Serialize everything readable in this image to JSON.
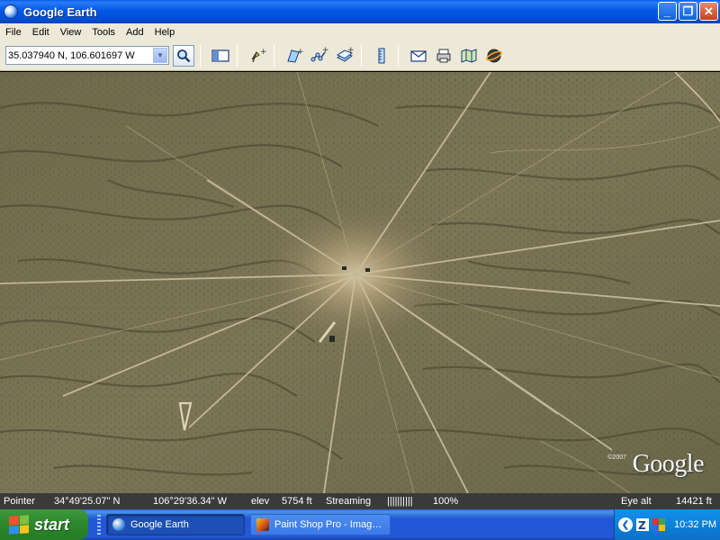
{
  "window": {
    "title": "Google Earth",
    "buttons": {
      "minimize": "_",
      "maximize": "❐",
      "close": "✕"
    }
  },
  "menu": {
    "items": [
      "File",
      "Edit",
      "View",
      "Tools",
      "Add",
      "Help"
    ]
  },
  "toolbar": {
    "search_value": "35.037940 N, 106.601697 W",
    "icons": [
      "search-icon",
      "sidebar-toggle-icon",
      "add-placemark-icon",
      "add-polygon-icon",
      "add-path-icon",
      "add-image-overlay-icon",
      "ruler-icon",
      "email-icon",
      "print-icon",
      "view-in-maps-icon",
      "sky-icon"
    ]
  },
  "map": {
    "copyright": "©2007",
    "logo": "Google",
    "colors": {
      "terrain": "#746e50",
      "roads": "#cbbfa0"
    }
  },
  "status": {
    "pointer_label": "Pointer",
    "latitude": "34°49'25.07\" N",
    "longitude": "106°29'36.34\" W",
    "elev_label": "elev",
    "elev_value": "5754 ft",
    "streaming_label": "Streaming",
    "streaming_bar": "||||||||||",
    "streaming_percent": "100%",
    "eye_alt_label": "Eye alt",
    "eye_alt_value": "14421 ft"
  },
  "taskbar": {
    "start_label": "start",
    "tasks": [
      {
        "label": "Google Earth",
        "active": true
      },
      {
        "label": "Paint Shop Pro - Imag…",
        "active": false
      }
    ],
    "clock": "10:32 PM"
  }
}
